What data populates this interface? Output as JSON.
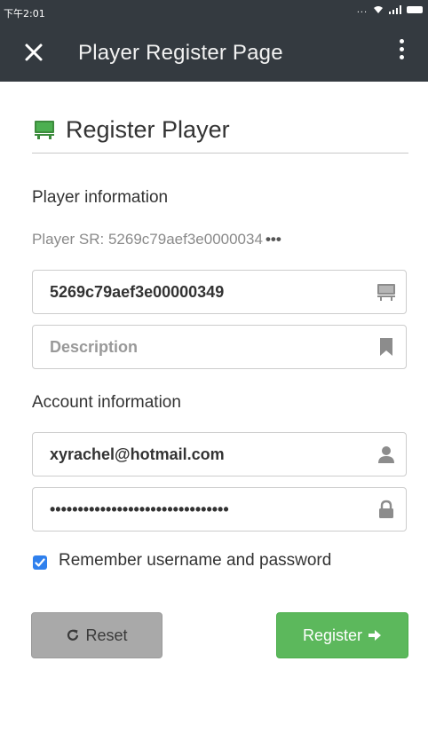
{
  "status_bar": {
    "time": "下午2:01",
    "dots": "..."
  },
  "app_bar": {
    "title": "Player Register Page",
    "close_icon": "close-icon",
    "menu_icon": "more-vertical-icon"
  },
  "heading": {
    "text": "Register Player",
    "icon": "monitor-icon"
  },
  "player_section": {
    "label": "Player information",
    "sr_label": "Player SR: 5269c79aef3e0000034",
    "sr_ellipsis": "•••",
    "id_field": {
      "value": "5269c79aef3e00000349",
      "icon": "monitor-icon"
    },
    "description_field": {
      "placeholder": "Description",
      "value": "",
      "icon": "bookmark-icon"
    }
  },
  "account_section": {
    "label": "Account information",
    "email_field": {
      "value": "xyrachel@hotmail.com",
      "icon": "user-icon"
    },
    "password_field": {
      "value": "••••••••••••••••••••••••••••••••",
      "icon": "lock-icon"
    },
    "remember": {
      "label": "Remember username and password",
      "checked": true
    }
  },
  "buttons": {
    "reset_label": "Reset",
    "reset_icon": "refresh-icon",
    "register_label": "Register",
    "register_icon": "arrow-right-icon"
  },
  "colors": {
    "app_bar": "#343a40",
    "register_button": "#5cb85c",
    "reset_button": "#a9a9a9",
    "heading_icon": "#3d8b3d",
    "checkbox": "#2f80ed"
  }
}
